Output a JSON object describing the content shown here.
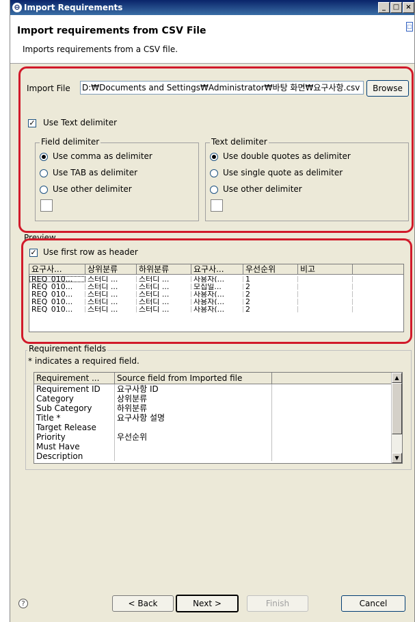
{
  "window": {
    "title": "Import Requirements",
    "controls": {
      "minimize": "_",
      "maximize": "□",
      "close": "×"
    }
  },
  "header": {
    "title": "Import requirements from CSV File",
    "description": "Imports requirements from a CSV file."
  },
  "import_file": {
    "label": "Import File",
    "value": "D:₩Documents and Settings₩Administrator₩바탕 화면₩요구사항.csv",
    "browse_label": "Browse"
  },
  "use_text_delimiter": {
    "label": "Use Text delimiter",
    "checked": true
  },
  "field_delimiter": {
    "title": "Field delimiter",
    "options": [
      {
        "label": "Use comma as delimiter",
        "selected": true
      },
      {
        "label": "Use TAB as delimiter",
        "selected": false
      },
      {
        "label": "Use other delimiter",
        "selected": false
      }
    ]
  },
  "text_delimiter": {
    "title": "Text delimiter",
    "options": [
      {
        "label": "Use double quotes as delimiter",
        "selected": true
      },
      {
        "label": "Use single quote as delimiter",
        "selected": false
      },
      {
        "label": "Use other delimiter",
        "selected": false
      }
    ]
  },
  "preview": {
    "title": "Preview",
    "use_first_row_label": "Use first row as header",
    "use_first_row_checked": true,
    "columns": [
      "요구사...",
      "상위분류",
      "하위분류",
      "요구사...",
      "우선순위",
      "비고"
    ],
    "rows": [
      [
        "REQ_010...",
        "스터디 ...",
        "스터디 ...",
        "사용자(...",
        "1",
        ""
      ],
      [
        "REQ_010...",
        "스터디 ...",
        "스터디 ...",
        "모집일...",
        "2",
        ""
      ],
      [
        "REQ_010...",
        "스터디 ...",
        "스터디 ...",
        "사용자(...",
        "2",
        ""
      ],
      [
        "REQ_010...",
        "스터디 ...",
        "스터디 ...",
        "사용자(...",
        "2",
        ""
      ],
      [
        "REQ_010...",
        "스터디 ...",
        "스터디 ...",
        "사용자(...",
        "2",
        ""
      ]
    ]
  },
  "requirement_fields": {
    "title": "Requirement fields",
    "note": "* indicates a required field.",
    "columns": [
      "Requirement ...",
      "Source field from Imported file"
    ],
    "rows": [
      [
        "Requirement ID",
        "요구사항 ID"
      ],
      [
        "Category",
        "상위분류"
      ],
      [
        "Sub Category",
        "하위분류"
      ],
      [
        "Title *",
        "요구사항 설명"
      ],
      [
        "Target Release",
        ""
      ],
      [
        "Priority",
        "우선순위"
      ],
      [
        "Must Have",
        ""
      ],
      [
        "Description",
        ""
      ]
    ]
  },
  "footer": {
    "help": "?",
    "back_label": "< Back",
    "next_label": "Next >",
    "finish_label": "Finish",
    "cancel_label": "Cancel"
  },
  "colors": {
    "highlight": "#d11a2a",
    "titlebar": "#0a246a",
    "dialog_bg": "#ece9d8"
  }
}
